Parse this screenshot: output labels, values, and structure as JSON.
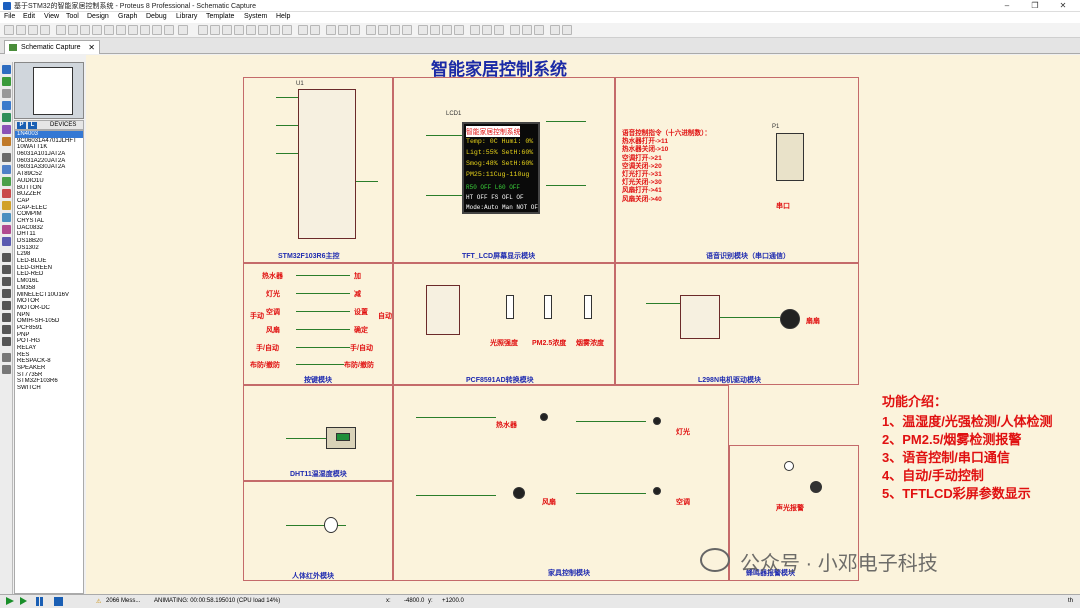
{
  "window": {
    "title": "基于STM32的智能家居控制系统 - Proteus 8 Professional - Schematic Capture"
  },
  "menu": [
    "File",
    "Edit",
    "View",
    "Tool",
    "Design",
    "Graph",
    "Debug",
    "Library",
    "Template",
    "System",
    "Help"
  ],
  "tab": {
    "label": "Schematic Capture",
    "close": "✕"
  },
  "devices": {
    "header": "DEVICES",
    "p_button": "P",
    "l_button": "L",
    "items": [
      "1N4003",
      "9C06031A4701JLHFT",
      "10WATT1K",
      "06031A101JAT2A",
      "06031A220JAT2A",
      "06031A330JAT2A",
      "AT89C52",
      "AUDIO1U",
      "BUTTON",
      "BUZZER",
      "CAP",
      "CAP-ELEC",
      "COMPIM",
      "CRYSTAL",
      "DAC0832",
      "DHT11",
      "DS18B20",
      "DS1302",
      "L298",
      "LED-BLUE",
      "LED-GREEN",
      "LED-RED",
      "LM016L",
      "LM358",
      "MINELECT10U16V",
      "MOTOR",
      "MOTOR-DC",
      "NPN",
      "OMIH-SH-105D",
      "PCF8591",
      "PNP",
      "POT-HG",
      "RELAY",
      "RES",
      "RESPACK-8",
      "SPEAKER",
      "ST7735R",
      "STM32F103R6",
      "SWITCH"
    ],
    "selected": "1N4003"
  },
  "schematic": {
    "title": "智能家居控制系统",
    "blocks": {
      "mcu": "STM32F103R6主控",
      "lcd": "TFT_LCD屏幕显示模块",
      "voice": "语音识别模块（串口通信）",
      "keys": "按键模块",
      "adc": "PCF8591AD转换模块",
      "motor": "L298N电机驱动模块",
      "dht": "DHT11温湿度模块",
      "pir": "人体红外模块",
      "home": "家具控制模块",
      "alarm": "蜂鸣器报警模块"
    },
    "labels": {
      "u1": "U1",
      "lcd1": "LCD1",
      "p1": "P1",
      "serial": "串口",
      "fan": "扇扇",
      "manual": "手动",
      "auto": "自动",
      "heater": "热水器",
      "fan2": "风扇",
      "light": "灯光",
      "ac": "空调",
      "sound_light": "声光报警",
      "light_intensity": "光照强度",
      "pm25": "PM2.5浓度",
      "smoke": "烟雾浓度"
    },
    "keys": [
      "热水器",
      "灯光",
      "空调",
      "风扇",
      "手/自动",
      "布防/撤防"
    ],
    "keys_right": [
      "加",
      "减",
      "设置",
      "确定",
      "手/自动",
      "布防/撤防"
    ],
    "voice_title": "语音控制指令（十六进制数）：",
    "voice_cmds": [
      "热水器打开->11",
      "热水器关闭->10",
      "空调打开->21",
      "空调关闭->20",
      "灯光打开->31",
      "灯光关闭->30",
      "风扇打开->41",
      "风扇关闭->40"
    ],
    "lcd_lines": [
      "智能家居控制系统",
      "Temp: 0C Humi: 0%",
      "Ligt:55% SetH:60%",
      "Smog:48% SetH:60%",
      "PM25:11Cug-110ug",
      "R50 OFF  L60 OFF",
      "HT OFF  FS OFL  OF",
      "Mode:Auto  Man NOT  OF"
    ],
    "intro_title": "功能介绍：",
    "intro": [
      "1、温湿度/光强检测/人体检测",
      "2、PM2.5/烟雾检测报警",
      "3、语音控制/串口通信",
      "4、自动/手动控制",
      "5、TFTLCD彩屏参数显示"
    ]
  },
  "status": {
    "messages": "2066 Mess...",
    "animating": "ANIMATING: 00:00:58.195010 (CPU load 14%)",
    "x_label": "x:",
    "x": "-4800.0",
    "y_label": "y:",
    "y": "+1200.0",
    "unit": "th"
  },
  "watermark": "公众号 · 小邓电子科技",
  "colors": {
    "title": "#1b2aa6",
    "red": "#e01010",
    "sheet_bg": "#fbf3dc",
    "border": "#c46a6a"
  }
}
